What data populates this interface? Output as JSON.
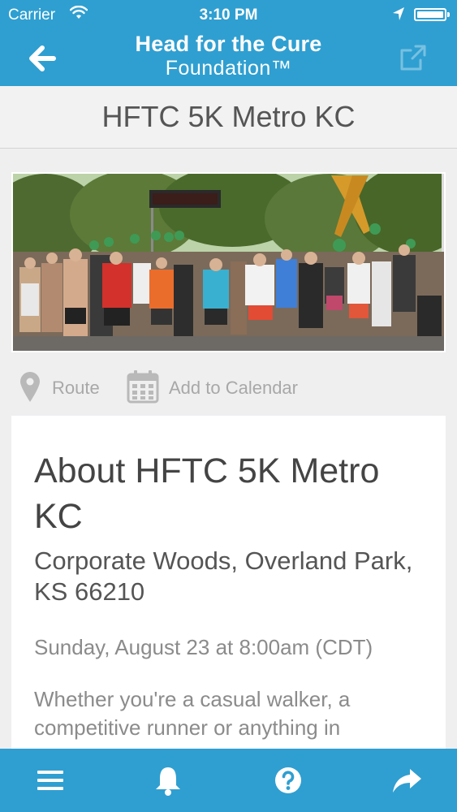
{
  "status_bar": {
    "carrier": "Carrier",
    "time": "3:10 PM"
  },
  "nav": {
    "brand_line1": "Head for the Cure",
    "brand_line2": "Foundation™",
    "back_icon": "arrow-left-icon",
    "share_icon": "external-share-icon"
  },
  "page": {
    "title": "HFTC 5K Metro KC"
  },
  "actions": {
    "route_label": "Route",
    "calendar_label": "Add to Calendar"
  },
  "about": {
    "heading": "About HFTC 5K Metro KC",
    "address": "Corporate Woods, Overland Park, KS 66210",
    "date": "Sunday, August 23 at 8:00am (CDT)",
    "description": "Whether you're a casual walker, a competitive runner or anything in"
  },
  "tabbar": {
    "items": [
      "menu-icon",
      "bell-icon",
      "help-icon",
      "share-icon"
    ]
  },
  "colors": {
    "brand_blue": "#2f9fd1",
    "background": "#efeff0",
    "muted_text": "#a8a8a8"
  }
}
